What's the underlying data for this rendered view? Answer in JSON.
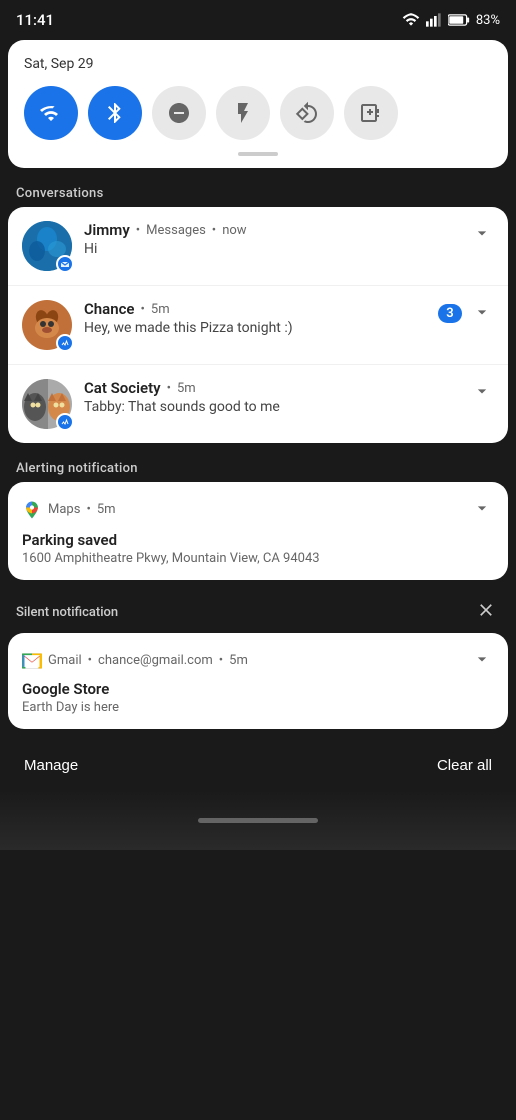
{
  "statusBar": {
    "time": "11:41",
    "battery": "83%"
  },
  "quickSettings": {
    "date": "Sat, Sep 29",
    "buttons": [
      {
        "id": "wifi",
        "label": "WiFi",
        "active": true
      },
      {
        "id": "bluetooth",
        "label": "Bluetooth",
        "active": true
      },
      {
        "id": "dnd",
        "label": "Do Not Disturb",
        "active": false
      },
      {
        "id": "flashlight",
        "label": "Flashlight",
        "active": false
      },
      {
        "id": "rotate",
        "label": "Auto Rotate",
        "active": false
      },
      {
        "id": "battery-saver",
        "label": "Battery Saver",
        "active": false
      }
    ]
  },
  "conversations": {
    "sectionLabel": "Conversations",
    "items": [
      {
        "name": "Jimmy",
        "appName": "Messages",
        "time": "now",
        "message": "Hi",
        "badgeCount": null,
        "avatarColor": "#1a7ac4"
      },
      {
        "name": "Chance",
        "appName": "",
        "time": "5m",
        "message": "Hey, we made this Pizza tonight :)",
        "badgeCount": "3",
        "avatarColor": "#c07038"
      },
      {
        "name": "Cat Society",
        "appName": "",
        "time": "5m",
        "message": "Tabby: That sounds good to me",
        "badgeCount": null,
        "avatarColor": "#888"
      }
    ]
  },
  "alertingNotification": {
    "sectionLabel": "Alerting notification",
    "appName": "Maps",
    "time": "5m",
    "title": "Parking saved",
    "body": "1600 Amphitheatre Pkwy, Mountain View, CA 94043"
  },
  "silentNotification": {
    "sectionLabel": "Silent notification",
    "appName": "Gmail",
    "email": "chance@gmail.com",
    "time": "5m",
    "title": "Google Store",
    "body": "Earth Day is here"
  },
  "bottomBar": {
    "manageLabel": "Manage",
    "clearAllLabel": "Clear all"
  },
  "icons": {
    "chevronDown": "▾",
    "close": "✕",
    "dot": "•"
  }
}
